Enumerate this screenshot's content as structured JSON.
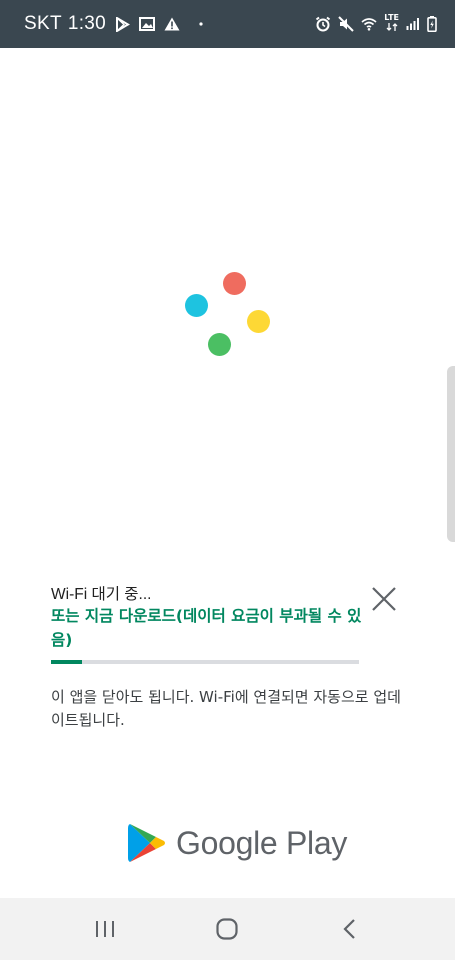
{
  "status_bar": {
    "carrier": "SKT",
    "time": "1:30",
    "network": "LTE",
    "left_icons": [
      "play-store-notification-icon",
      "image-notification-icon",
      "warning-icon",
      "dot-icon"
    ],
    "right_icons": [
      "alarm-icon",
      "mute-icon",
      "wifi-icon",
      "lte-icon",
      "signal-icon",
      "battery-icon"
    ]
  },
  "loader": {
    "colors": [
      "#ef6c5f",
      "#1ec3e0",
      "#fdd835",
      "#4bbf63"
    ]
  },
  "download": {
    "status_title": "Wi-Fi 대기 중...",
    "download_now_link": "또는 지금 다운로드(데이터 요금이 부과될 수 있음)",
    "progress_fraction": 0.1,
    "info_text": "이 앱을 닫아도 됩니다. Wi‑Fi에 연결되면 자동으로 업데이트됩니다.",
    "accent_color": "#01875f"
  },
  "branding": {
    "name": "Google Play"
  },
  "nav_bar": {
    "buttons": [
      "recent-apps",
      "home",
      "back"
    ]
  }
}
